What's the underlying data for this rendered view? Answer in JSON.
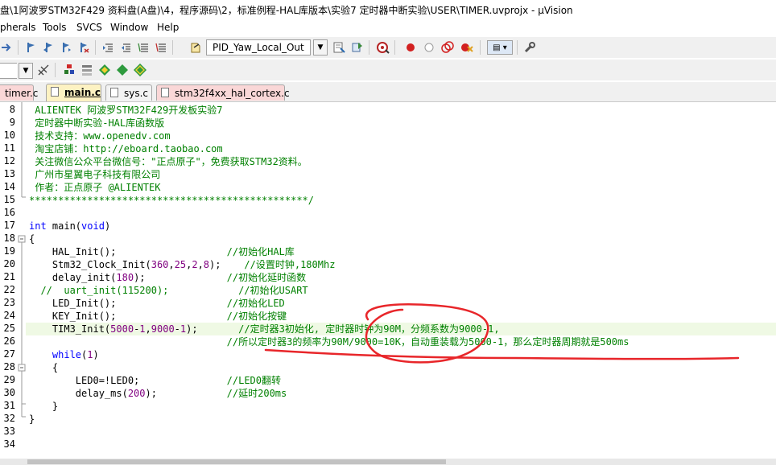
{
  "window": {
    "title": "盘\\1阿波罗STM32F429 资料盘(A盘)\\4，程序源码\\2，标准例程-HAL库版本\\实验7 定时器中断实验\\USER\\TIMER.uvprojx - µVision"
  },
  "menu": {
    "items": [
      "pherals",
      "Tools",
      "SVCS",
      "Window",
      "Help"
    ]
  },
  "toolbar": {
    "target": "PID_Yaw_Local_Out"
  },
  "tabs": [
    {
      "label": "timer.c",
      "active": false
    },
    {
      "label": "main.c",
      "active": true
    },
    {
      "label": "sys.c",
      "active": false
    },
    {
      "label": "stm32f4xx_hal_cortex.c",
      "active": false
    }
  ],
  "lines": [
    {
      "n": "8",
      "segs": [
        {
          "t": " ALIENTEK 阿波罗STM32F429开发板实验7",
          "c": "cm"
        }
      ]
    },
    {
      "n": "9",
      "segs": [
        {
          "t": " 定时器中断实验-HAL库函数版",
          "c": "cm"
        }
      ]
    },
    {
      "n": "10",
      "segs": [
        {
          "t": " 技术支持：www.openedv.com",
          "c": "cm"
        }
      ]
    },
    {
      "n": "11",
      "segs": [
        {
          "t": " 淘宝店铺：http://eboard.taobao.com",
          "c": "cm"
        }
      ]
    },
    {
      "n": "12",
      "segs": [
        {
          "t": " 关注微信公众平台微信号：\"正点原子\"，免费获取STM32资料。",
          "c": "cm"
        }
      ]
    },
    {
      "n": "13",
      "segs": [
        {
          "t": " 广州市星翼电子科技有限公司",
          "c": "cm"
        }
      ]
    },
    {
      "n": "14",
      "segs": [
        {
          "t": " 作者：正点原子 @ALIENTEK",
          "c": "cm"
        }
      ]
    },
    {
      "n": "15",
      "segs": [
        {
          "t": "************************************************/",
          "c": "cm"
        }
      ]
    },
    {
      "n": "16",
      "segs": []
    },
    {
      "n": "17",
      "segs": [
        {
          "t": "int",
          "c": "kw"
        },
        {
          "t": " main(",
          "c": ""
        },
        {
          "t": "void",
          "c": "kw"
        },
        {
          "t": ")",
          "c": ""
        }
      ]
    },
    {
      "n": "18",
      "segs": [
        {
          "t": "{",
          "c": ""
        }
      ]
    },
    {
      "n": "19",
      "segs": [
        {
          "t": "    HAL_Init();                   ",
          "c": ""
        },
        {
          "t": "//初始化HAL库",
          "c": "cm"
        }
      ]
    },
    {
      "n": "20",
      "segs": [
        {
          "t": "    Stm32_Clock_Init(",
          "c": ""
        },
        {
          "t": "360",
          "c": "nm"
        },
        {
          "t": ",",
          "c": ""
        },
        {
          "t": "25",
          "c": "nm"
        },
        {
          "t": ",",
          "c": ""
        },
        {
          "t": "2",
          "c": "nm"
        },
        {
          "t": ",",
          "c": ""
        },
        {
          "t": "8",
          "c": "nm"
        },
        {
          "t": ");    ",
          "c": ""
        },
        {
          "t": "//设置时钟,180Mhz",
          "c": "cm"
        }
      ]
    },
    {
      "n": "21",
      "segs": [
        {
          "t": "    delay_init(",
          "c": ""
        },
        {
          "t": "180",
          "c": "nm"
        },
        {
          "t": ");              ",
          "c": ""
        },
        {
          "t": "//初始化延时函数",
          "c": "cm"
        }
      ]
    },
    {
      "n": "22",
      "segs": [
        {
          "t": "  //  uart_init(115200);            //初始化USART",
          "c": "cm"
        }
      ]
    },
    {
      "n": "23",
      "segs": [
        {
          "t": "    LED_Init();                   ",
          "c": ""
        },
        {
          "t": "//初始化LED",
          "c": "cm"
        }
      ]
    },
    {
      "n": "24",
      "segs": [
        {
          "t": "    KEY_Init();                   ",
          "c": ""
        },
        {
          "t": "//初始化按键",
          "c": "cm"
        }
      ]
    },
    {
      "n": "25",
      "segs": [
        {
          "t": "    TIM3_Init(",
          "c": ""
        },
        {
          "t": "5000",
          "c": "nm"
        },
        {
          "t": "-",
          "c": ""
        },
        {
          "t": "1",
          "c": "nm"
        },
        {
          "t": ",",
          "c": ""
        },
        {
          "t": "9000",
          "c": "nm"
        },
        {
          "t": "-",
          "c": ""
        },
        {
          "t": "1",
          "c": "nm"
        },
        {
          "t": ");       ",
          "c": ""
        },
        {
          "t": "//定时器3初始化, 定时器时钟为90M，分频系数为9000-1,",
          "c": "cm"
        }
      ]
    },
    {
      "n": "26",
      "segs": [
        {
          "t": "                                  ",
          "c": ""
        },
        {
          "t": "//所以定时器3的频率为90M/9000=10K，自动重装载为5000-1，那么定时器周期就是500ms",
          "c": "cm"
        }
      ]
    },
    {
      "n": "27",
      "segs": [
        {
          "t": "    ",
          "c": ""
        },
        {
          "t": "while",
          "c": "kw"
        },
        {
          "t": "(",
          "c": ""
        },
        {
          "t": "1",
          "c": "nm"
        },
        {
          "t": ")",
          "c": ""
        }
      ]
    },
    {
      "n": "28",
      "segs": [
        {
          "t": "    {",
          "c": ""
        }
      ]
    },
    {
      "n": "29",
      "segs": [
        {
          "t": "        LED0=!LED0;               ",
          "c": ""
        },
        {
          "t": "//LED0翻转",
          "c": "cm"
        }
      ]
    },
    {
      "n": "30",
      "segs": [
        {
          "t": "        delay_ms(",
          "c": ""
        },
        {
          "t": "200",
          "c": "nm"
        },
        {
          "t": ");            ",
          "c": ""
        },
        {
          "t": "//延时200ms",
          "c": "cm"
        }
      ]
    },
    {
      "n": "31",
      "segs": [
        {
          "t": "    }",
          "c": ""
        }
      ]
    },
    {
      "n": "32",
      "segs": [
        {
          "t": "}",
          "c": ""
        }
      ]
    },
    {
      "n": "33",
      "segs": []
    },
    {
      "n": "34",
      "segs": []
    }
  ],
  "colors": {
    "keyword": "#0000ff",
    "comment": "#008000",
    "number": "#800080",
    "current_line": "#eff9e4",
    "annotation": "#e8262a",
    "active_tab": "#fdf2c2",
    "red_tab": "#fad7d7"
  }
}
